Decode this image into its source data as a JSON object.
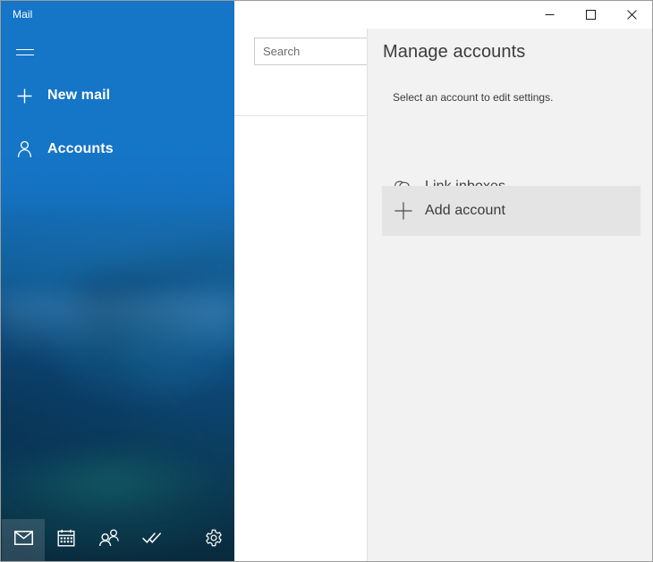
{
  "window": {
    "title": "Mail",
    "controls": {
      "minimize": "Minimize",
      "maximize": "Maximize",
      "close": "Close"
    }
  },
  "nav_pane": {
    "menu_button": "Menu",
    "commands": [
      {
        "icon": "plus-icon",
        "label": "New mail"
      },
      {
        "icon": "person-icon",
        "label": "Accounts"
      }
    ],
    "switcher": [
      {
        "icon": "mail-icon",
        "label": "Mail",
        "selected": true
      },
      {
        "icon": "calendar-icon",
        "label": "Calendar",
        "selected": false
      },
      {
        "icon": "people-icon",
        "label": "People",
        "selected": false
      },
      {
        "icon": "todo-icon",
        "label": "To Do",
        "selected": false
      },
      {
        "icon": "gear-icon",
        "label": "Settings",
        "selected": false
      }
    ]
  },
  "list_pane": {
    "search": {
      "placeholder": "Search",
      "value": ""
    }
  },
  "settings_pane": {
    "title": "Manage accounts",
    "subtitle": "Select an account to edit settings.",
    "rows": [
      {
        "icon": "link-icon",
        "label": "Link inboxes",
        "selected": false
      },
      {
        "icon": "plus-icon",
        "label": "Add account",
        "selected": true
      }
    ]
  },
  "colors": {
    "accent": "#1575c6",
    "pane_background": "#f2f2f2",
    "row_selected": "#e4e4e4",
    "text_primary": "#3b3b3b"
  }
}
